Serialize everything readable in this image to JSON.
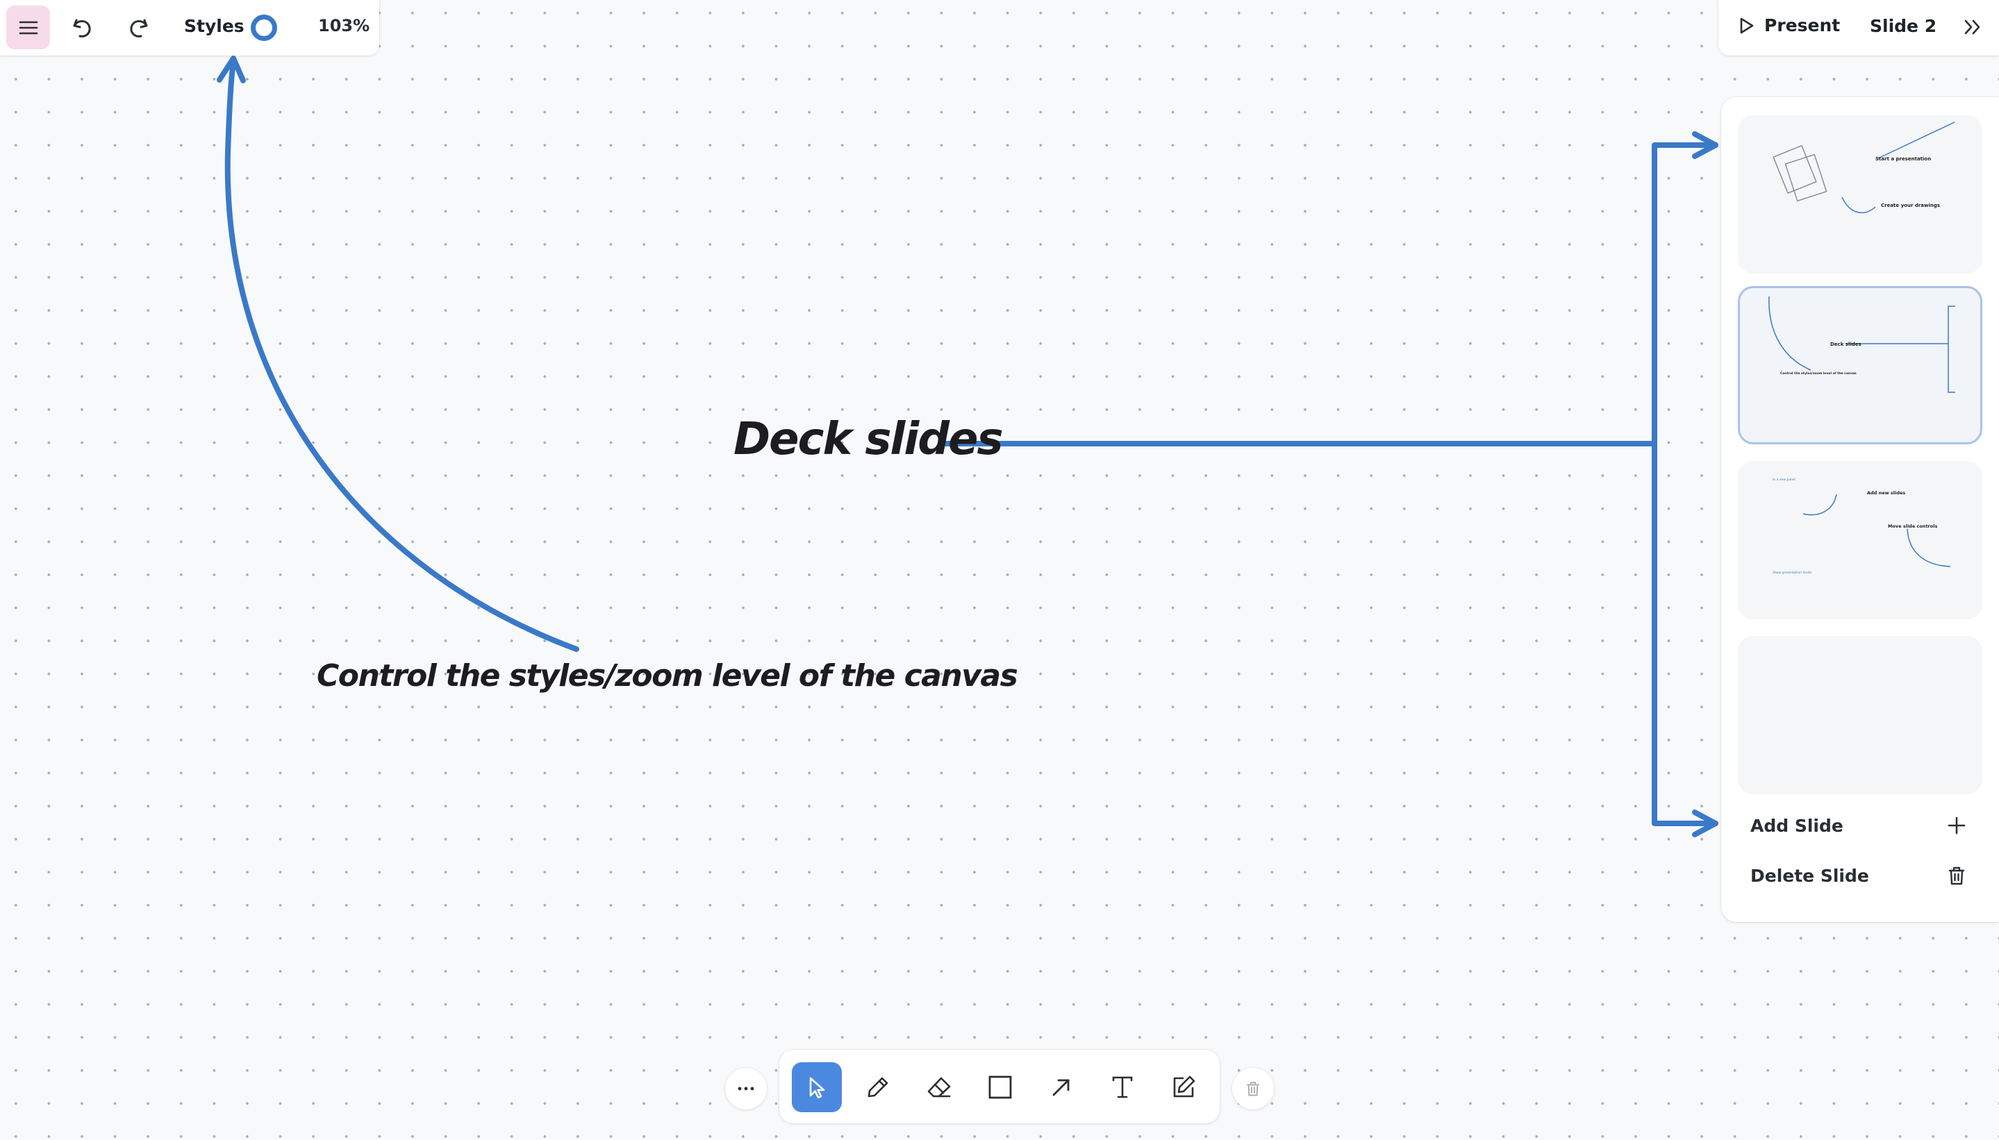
{
  "toolbar": {
    "menu_icon": "hamburger-icon",
    "undo_icon": "undo-icon",
    "redo_icon": "redo-icon",
    "styles_label": "Styles",
    "style_color": "#3a79c8",
    "zoom_level": "103%"
  },
  "presentation": {
    "present_label": "Present",
    "present_icon": "play-icon",
    "current_slide": "Slide 2",
    "collapse_icon": "chevrons-right-icon"
  },
  "slides_panel": {
    "thumbnails": [
      {
        "texts": [
          "Start a presentation",
          "Create your drawings"
        ]
      },
      {
        "texts": [
          "Deck slides",
          "Control the styles/zoom level of the canvas"
        ],
        "active": true
      },
      {
        "texts": [
          "Add new slides",
          "Move slide controls",
          "In a new panel",
          "Show presentation mode"
        ]
      },
      {
        "texts": []
      }
    ],
    "add_slide_label": "Add Slide",
    "add_slide_icon": "plus-icon",
    "delete_slide_label": "Delete Slide",
    "delete_slide_icon": "trash-icon"
  },
  "canvas": {
    "deck_title": "Deck slides",
    "control_note": "Control the styles/zoom level of the canvas",
    "stroke_color": "#3a79c8"
  },
  "bottom_toolbar": {
    "more_icon": "ellipsis-icon",
    "tools": [
      "select-tool",
      "pencil-tool",
      "eraser-tool",
      "rectangle-tool",
      "arrow-tool",
      "text-tool",
      "note-tool"
    ],
    "active_tool": "select-tool",
    "delete_icon": "trash-icon"
  }
}
